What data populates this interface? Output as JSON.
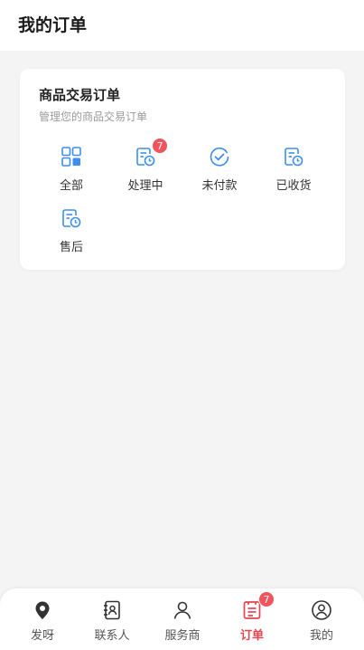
{
  "header": {
    "title": "我的订单"
  },
  "colors": {
    "accent": "#e8434f",
    "blue": "#3d8ef0",
    "badge": "#f0545c"
  },
  "card": {
    "title": "商品交易订单",
    "subtitle": "管理您的商品交易订单",
    "items": [
      {
        "label": "全部",
        "icon": "grid-icon"
      },
      {
        "label": "处理中",
        "icon": "document-clock-icon",
        "badge": "7"
      },
      {
        "label": "未付款",
        "icon": "check-circle-icon"
      },
      {
        "label": "已收货",
        "icon": "document-clock-icon"
      },
      {
        "label": "售后",
        "icon": "document-clock-icon"
      }
    ]
  },
  "tabbar": {
    "items": [
      {
        "label": "发呀",
        "icon": "location-pin-icon"
      },
      {
        "label": "联系人",
        "icon": "contacts-icon"
      },
      {
        "label": "服务商",
        "icon": "user-icon"
      },
      {
        "label": "订单",
        "icon": "orders-icon",
        "badge": "7",
        "active": true
      },
      {
        "label": "我的",
        "icon": "profile-icon"
      }
    ]
  }
}
